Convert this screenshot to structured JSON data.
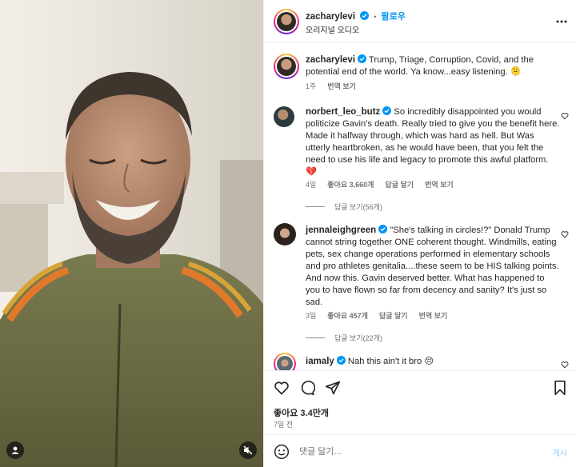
{
  "header": {
    "username": "zacharylevi",
    "separator": "•",
    "follow_label": "팔로우",
    "audio_label": "오리지널 오디오",
    "more_icon": "more-horizontal-icon"
  },
  "caption": {
    "username": "zacharylevi",
    "text": "Trump, Triage, Corruption, Covid, and the potential end of the world. Ya know...easy listening. 🫠",
    "time": "1주",
    "translate": "번역 보기"
  },
  "comments": [
    {
      "username": "norbert_leo_butz",
      "text": "So incredibly disappointed you would politicize Gavin's death. Really tried to give you the benefit here. Made it halfway through, which was hard as hell. But Was utterly heartbroken, as he would have been, that you felt the need to use his life and legacy to promote this awful platform. 💔",
      "time": "4일",
      "likes": "좋아요 3,660개",
      "reply": "답글 달기",
      "translate": "번역 보기",
      "view_replies": "답글 보기(56개)"
    },
    {
      "username": "jennaleighgreen",
      "text": "\"She's talking in circles!?\" Donald Trump cannot string together ONE coherent thought. Windmills, eating pets, sex change operations performed in elementary schools and pro athletes genitalia....these seem to be HIS talking points. And now this. Gavin deserved better. What has happened to you to have flown so far from decency and sanity? It's just so sad.",
      "time": "3일",
      "likes": "좋아요 457개",
      "reply": "답글 달기",
      "translate": "번역 보기",
      "view_replies": "답글 보기(22개)"
    },
    {
      "username": "iamaly",
      "text": "Nah this ain't it bro 😔"
    }
  ],
  "actions": {
    "icons": [
      "heart-icon",
      "comment-icon",
      "share-icon",
      "bookmark-icon"
    ],
    "likes": "좋아요 3.4만개",
    "posted": "7일 전"
  },
  "composer": {
    "placeholder": "댓글 달기...",
    "post_label": "게시",
    "emoji_icon": "emoji-icon"
  },
  "colors": {
    "accent": "#0095f6",
    "text": "#262626",
    "muted": "#737373",
    "verified": "#0095f6",
    "jacket_green": "#6d6b43",
    "stripe_orange": "#e07a2a"
  }
}
